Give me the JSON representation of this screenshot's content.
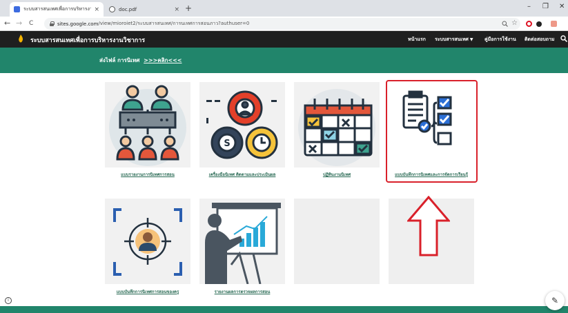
{
  "browser": {
    "tabs": [
      {
        "title": "ระบบสารสนเทศเพื่อการบริหารงานวิชาก",
        "active": true,
        "favicon_color": "#3c6be0"
      },
      {
        "title": "doc.pdf",
        "active": false,
        "favicon_color": "#555555"
      }
    ],
    "tab_close_glyph": "×",
    "new_tab_glyph": "+",
    "window_controls": {
      "minimize": "–",
      "maximize": "❐",
      "close": "✕"
    },
    "nav": {
      "back": "←",
      "forward": "→",
      "reload": "C"
    },
    "address": {
      "host": "sites.google.com",
      "path": "/view/mioroiet2/ระบบสารสนเทศ/การนเทศการสอนภาว?authuser=0"
    },
    "toolbar_icons": [
      "zoom-icon",
      "star-icon",
      "opera-icon",
      "extension-icon",
      "user-icon"
    ]
  },
  "site": {
    "title": "ระบบสารสนเทศเพื่อการบริหารงานวิชาการ",
    "nav_items": [
      "หน้าแรก",
      "ระบบสารสนเทศ",
      "คู่มือการใช้งาน",
      "ติดต่อสอบถาม"
    ],
    "search_glyph": "🔍",
    "accent_color": "#21856b",
    "header_color": "#1f1f1f"
  },
  "banner": {
    "text": "ส่งไฟล์ การนิเทศ",
    "link": ">>>คลิก<<<"
  },
  "cards": [
    {
      "caption": "แบบรายงานการนิเทศการสอน",
      "icon": "org-chart-icon"
    },
    {
      "caption": "เครื่องมือนิเทศ ติดตามและประเมินผล",
      "icon": "gears-icon"
    },
    {
      "caption": "ปฏิทินงานนิเทศ",
      "icon": "calendar-icon"
    },
    {
      "caption": "แบบบันทึกการนิเทศและการจัดการเรียนรู้",
      "icon": "checklist-icon",
      "highlighted": true
    },
    {
      "caption": "แบบบันทึกการนิเทศการสอนของครู",
      "icon": "target-person-icon"
    },
    {
      "caption": "รายงานผลการตรวจผลการสอน",
      "icon": "presentation-icon"
    },
    {
      "caption": "",
      "icon": ""
    },
    {
      "caption": "",
      "icon": ""
    }
  ],
  "highlight_color": "#d9202a",
  "fab_glyph": "✎",
  "info_glyph": "i"
}
